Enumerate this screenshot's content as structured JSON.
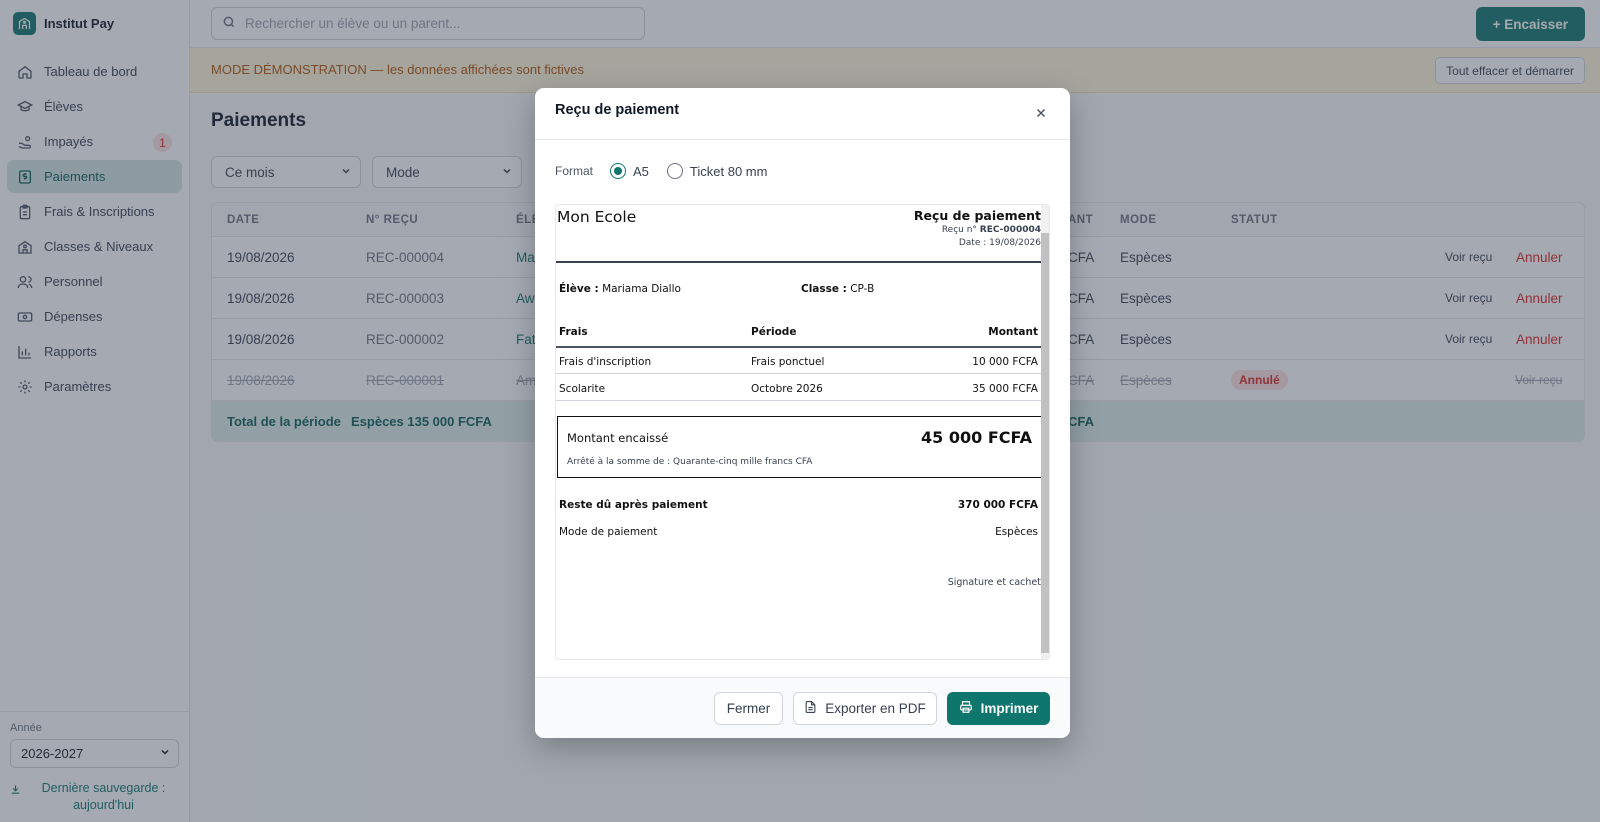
{
  "app": {
    "name": "Institut Pay"
  },
  "sidebar": {
    "items": [
      {
        "label": "Tableau de bord",
        "icon": "home-icon"
      },
      {
        "label": "Élèves",
        "icon": "graduation-cap-icon"
      },
      {
        "label": "Impayés",
        "icon": "hand-coins-icon",
        "badge": "1"
      },
      {
        "label": "Paiements",
        "icon": "receipt-icon",
        "active": true
      },
      {
        "label": "Frais & Inscriptions",
        "icon": "clipboard-icon"
      },
      {
        "label": "Classes & Niveaux",
        "icon": "school-icon"
      },
      {
        "label": "Personnel",
        "icon": "users-icon"
      },
      {
        "label": "Dépenses",
        "icon": "banknote-icon"
      },
      {
        "label": "Rapports",
        "icon": "bar-chart-icon"
      },
      {
        "label": "Paramètres",
        "icon": "gear-icon"
      }
    ],
    "year_label": "Année",
    "year_value": "2026-2027",
    "backup_text": "Dernière sauvegarde : aujourd'hui"
  },
  "topbar": {
    "search_placeholder": "Rechercher un élève ou un parent...",
    "encaisser_label": "+ Encaisser"
  },
  "banner": {
    "text": "MODE DÉMONSTRATION — les données affichées sont fictives",
    "button": "Tout effacer et démarrer"
  },
  "main": {
    "title": "Paiements",
    "filters": {
      "period": "Ce mois",
      "mode": "Mode"
    },
    "table": {
      "headers": {
        "date": "DATE",
        "receipt": "N° REÇU",
        "student": "ÉLÈ",
        "amount": "ANT",
        "mode": "MODE",
        "status": "STATUT"
      },
      "rows": [
        {
          "date": "19/08/2026",
          "receipt": "REC-000004",
          "student": "Ma",
          "amount": "CFA",
          "mode": "Espèces",
          "status": "",
          "view": "Voir reçu",
          "cancel": "Annuler"
        },
        {
          "date": "19/08/2026",
          "receipt": "REC-000003",
          "student": "Aw",
          "amount": "CFA",
          "mode": "Espèces",
          "status": "",
          "view": "Voir reçu",
          "cancel": "Annuler"
        },
        {
          "date": "19/08/2026",
          "receipt": "REC-000002",
          "student": "Fat",
          "amount": "CFA",
          "mode": "Espèces",
          "status": "",
          "view": "Voir reçu",
          "cancel": "Annuler"
        },
        {
          "date": "19/08/2026",
          "receipt": "REC-000001",
          "student": "Am",
          "amount": "CFA",
          "mode": "Espèces",
          "status": "Annulé",
          "view": "Voir reçu",
          "cancel": ""
        }
      ],
      "total_label": "Total de la période",
      "total_value": "Espèces 135 000 FCFA",
      "total_amount": "CFA"
    }
  },
  "modal": {
    "title": "Reçu de paiement",
    "format_label": "Format",
    "format_options": [
      "A5",
      "Ticket 80 mm"
    ],
    "format_selected": "A5",
    "receipt": {
      "school": "Mon Ecole",
      "title": "Reçu de paiement",
      "number_label": "Reçu n°",
      "number": "REC-000004",
      "date": "Date : 19/08/2026",
      "student_label": "Élève :",
      "student": "Mariama Diallo",
      "class_label": "Classe :",
      "class": "CP-B",
      "columns": {
        "fee": "Frais",
        "period": "Période",
        "amount": "Montant"
      },
      "lines": [
        {
          "fee": "Frais d'inscription",
          "period": "Frais ponctuel",
          "amount": "10 000 FCFA"
        },
        {
          "fee": "Scolarite",
          "period": "Octobre 2026",
          "amount": "35 000 FCFA"
        }
      ],
      "collected_label": "Montant encaissé",
      "collected_amount": "45 000 FCFA",
      "words": "Arrêté à la somme de : Quarante-cinq mille francs CFA",
      "remaining_label": "Reste dû après paiement",
      "remaining_amount": "370 000 FCFA",
      "mode_label": "Mode de paiement",
      "mode": "Espèces",
      "signature": "Signature et cachet"
    },
    "buttons": {
      "close": "Fermer",
      "pdf": "Exporter en PDF",
      "print": "Imprimer"
    }
  },
  "colors": {
    "accent": "#0f766e",
    "danger": "#dc2626",
    "warning": "#b45309"
  }
}
